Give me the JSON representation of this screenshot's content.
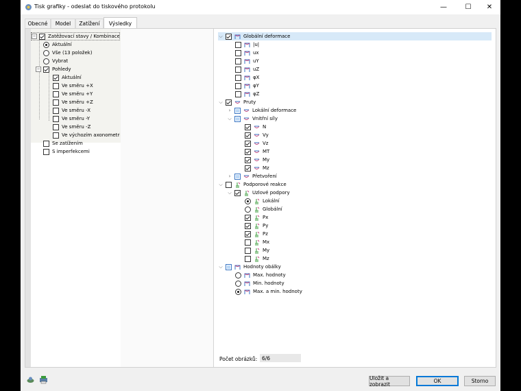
{
  "window": {
    "title": "Tisk grafiky - odeslat do tiskového protokolu"
  },
  "window_controls": {
    "minimize": "—",
    "maximize": "☐",
    "close": "✕"
  },
  "tabs": [
    {
      "label": "Obecné"
    },
    {
      "label": "Model"
    },
    {
      "label": "Zatížení"
    },
    {
      "label": "Výsledky"
    }
  ],
  "left_tree": {
    "root": "Zatěžovací stavy / Kombinace zatížení",
    "aktualni": "Aktuální",
    "vse": "Vše (13 položek)",
    "vybrat": "Vybrat",
    "pohledy": "Pohledy",
    "views": [
      "Aktuální",
      "Ve směru +X",
      "Ve směru +Y",
      "Ve směru +Z",
      "Ve směru -X",
      "Ve směru -Y",
      "Ve směru -Z",
      "Ve výchozím axonometrickém pohledu"
    ],
    "se_zatizenim": "Se zatížením",
    "s_imperfekcemi": "S imperfekcemi"
  },
  "right_tree": {
    "globalni_deformace": "Globální deformace",
    "deformace_items": [
      "|u|",
      "ux",
      "uY",
      "uZ",
      "φX",
      "φY",
      "φZ"
    ],
    "pruty": "Pruty",
    "lokalni_deformace": "Lokální deformace",
    "vnitrni_sily": "Vnitřní síly",
    "sily_items": [
      "N",
      "Vy",
      "Vz",
      "MT",
      "My",
      "Mz"
    ],
    "pretvoreni": "Přetvoření",
    "podporove_reakce": "Podporové reakce",
    "uzlove_podpory": "Uzlové podpory",
    "lokalni": "Lokální",
    "globalni": "Globální",
    "reakce_items": [
      "Px",
      "Py",
      "Pz",
      "Mx",
      "My",
      "Mz"
    ],
    "hodnoty_obalky": "Hodnoty obálky",
    "max_hodnoty": "Max. hodnoty",
    "min_hodnoty": "Min. hodnoty",
    "max_min_hodnoty": "Max. a min. hodnoty"
  },
  "footer": {
    "pocet_label": "Počet obrázků:",
    "pocet_value": "6/6"
  },
  "buttons": {
    "save_show": "Uložit a zobrazit",
    "ok": "OK",
    "cancel": "Storno"
  },
  "colors": {
    "accent": "#0078d7",
    "icon_blue": "#3a76c4",
    "icon_pink": "#c0407a",
    "icon_green": "#3a9a3a"
  }
}
